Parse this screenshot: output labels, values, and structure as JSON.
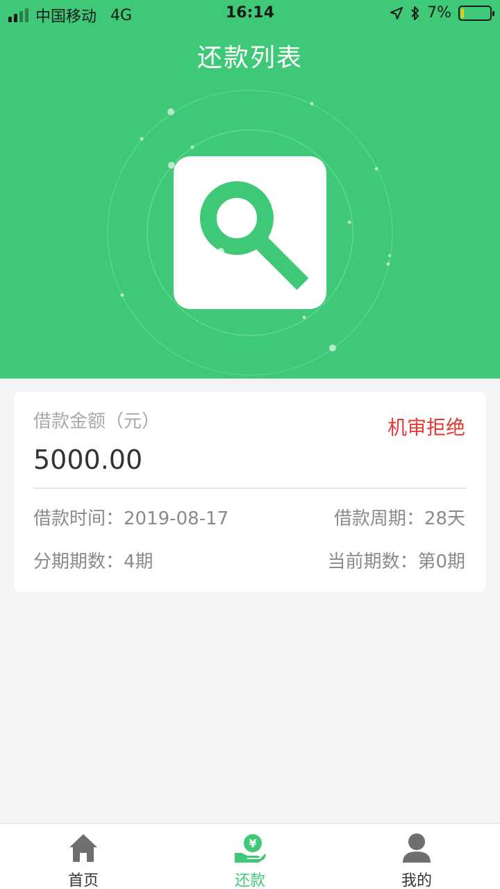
{
  "status_bar": {
    "carrier": "中国移动",
    "network": "4G",
    "time": "16:14",
    "battery": "7%",
    "battery_level": 0.07
  },
  "header": {
    "title": "还款列表"
  },
  "loan_card": {
    "amount_label": "借款金额（元）",
    "amount_value": "5000.00",
    "status": "机审拒绝",
    "loan_time_label": "借款时间：",
    "loan_time_value": "2019-08-17",
    "loan_period_label": "借款周期：",
    "loan_period_value": "28天",
    "installments_label": "分期期数：",
    "installments_value": "4期",
    "current_period_label": "当前期数：",
    "current_period_value": "第0期"
  },
  "tabbar": {
    "items": [
      {
        "label": "首页",
        "icon": "home-icon"
      },
      {
        "label": "还款",
        "icon": "repay-icon"
      },
      {
        "label": "我的",
        "icon": "user-icon"
      }
    ],
    "active_color": "#3ec878"
  },
  "colors": {
    "brand_green": "#3ec878",
    "status_red": "#e53935"
  }
}
